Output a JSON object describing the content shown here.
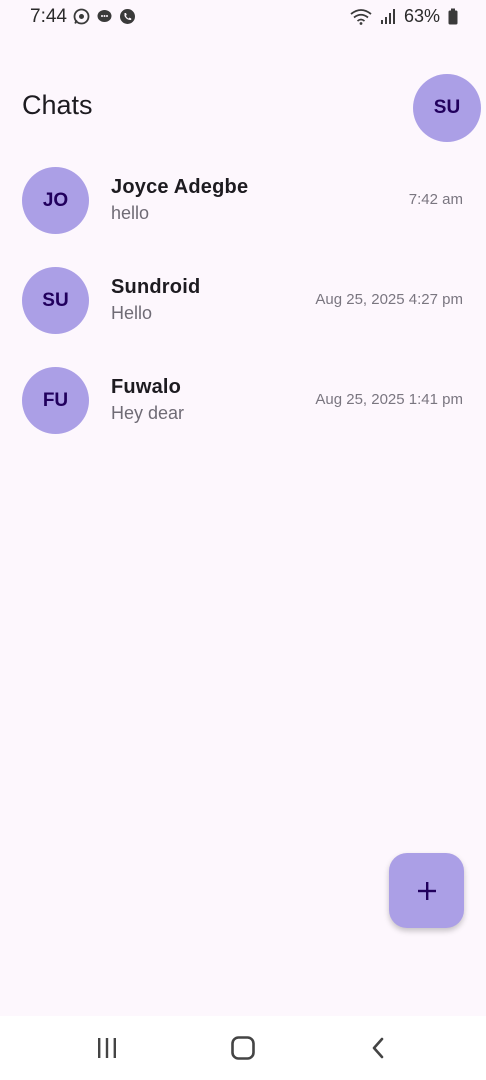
{
  "status_bar": {
    "time": "7:44",
    "battery": "63%",
    "left_icons": [
      "whatsapp-icon",
      "chat-bubble-icon",
      "phone-icon"
    ],
    "right_icons": [
      "wifi-icon",
      "signal-icon",
      "battery-icon"
    ]
  },
  "header": {
    "title": "Chats",
    "profile_initials": "SU"
  },
  "chats": [
    {
      "initials": "JO",
      "name": "Joyce Adegbe",
      "preview": "hello",
      "time": "7:42 am"
    },
    {
      "initials": "SU",
      "name": "Sundroid",
      "preview": "Hello",
      "time": "Aug 25, 2025 4:27 pm"
    },
    {
      "initials": "FU",
      "name": "Fuwalo",
      "preview": "Hey dear",
      "time": "Aug 25, 2025 1:41 pm"
    }
  ],
  "fab": {
    "icon": "plus-icon"
  },
  "nav": {
    "icons": [
      "recent-apps-icon",
      "home-icon",
      "back-icon"
    ]
  },
  "colors": {
    "background": "#fdf7fd",
    "avatar": "#ab9fe6",
    "avatar_text": "#21005d"
  }
}
